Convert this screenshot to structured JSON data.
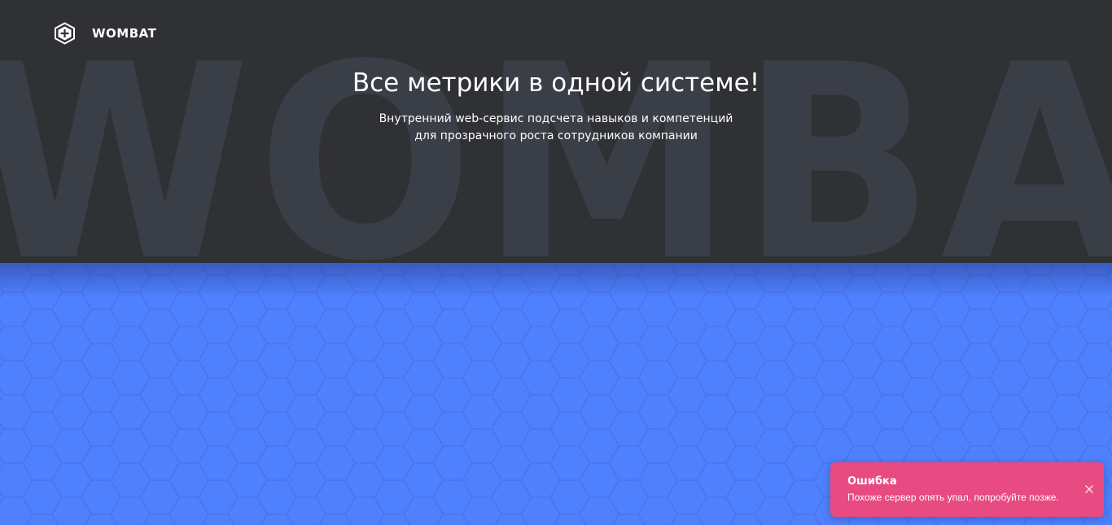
{
  "header": {
    "brand_name": "WOMBAT",
    "logo_icon": "hexagon-plus-icon"
  },
  "hero": {
    "background_word": "WOMBAT",
    "title": "Все метрики в одной системе!",
    "subtitle_line1": "Внутренний web-сервис подсчета навыков и компетенций",
    "subtitle_line2": "для прозрачного роста сотрудников компании"
  },
  "toast": {
    "title": "Ошибка",
    "message": "Похоже сервер опять упал, попробуйте позже.",
    "close_icon": "close-icon"
  },
  "colors": {
    "hero_bg": "#303134",
    "accent_blue": "#4f80fe",
    "toast_bg": "#e84a82"
  }
}
